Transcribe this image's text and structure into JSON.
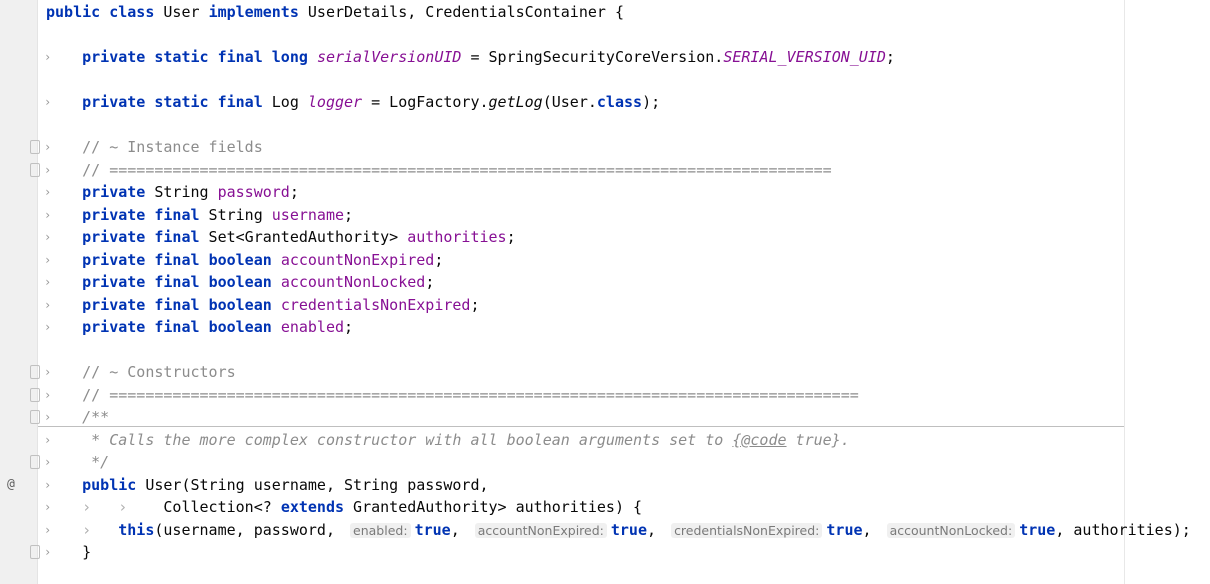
{
  "editor": {
    "language": "java",
    "lines": [
      {
        "fold": "",
        "tokens": [
          [
            "kw",
            "public"
          ],
          [
            "t",
            " "
          ],
          [
            "kw",
            "class"
          ],
          [
            "t",
            " User "
          ],
          [
            "kw",
            "implements"
          ],
          [
            "t",
            " UserDetails, CredentialsContainer {"
          ]
        ]
      },
      {
        "fold": "",
        "tokens": []
      },
      {
        "fold": "›",
        "tokens": [
          [
            "t",
            "    "
          ],
          [
            "kw",
            "private"
          ],
          [
            "t",
            " "
          ],
          [
            "kw",
            "static"
          ],
          [
            "t",
            " "
          ],
          [
            "kw",
            "final"
          ],
          [
            "t",
            " "
          ],
          [
            "kw",
            "long"
          ],
          [
            "t",
            " "
          ],
          [
            "fst",
            "serialVersionUID"
          ],
          [
            "t",
            " = SpringSecurityCoreVersion."
          ],
          [
            "fst",
            "SERIAL_VERSION_UID"
          ],
          [
            "t",
            ";"
          ]
        ]
      },
      {
        "fold": "",
        "tokens": []
      },
      {
        "fold": "›",
        "tokens": [
          [
            "t",
            "    "
          ],
          [
            "kw",
            "private"
          ],
          [
            "t",
            " "
          ],
          [
            "kw",
            "static"
          ],
          [
            "t",
            " "
          ],
          [
            "kw",
            "final"
          ],
          [
            "t",
            " Log "
          ],
          [
            "fst",
            "logger"
          ],
          [
            "t",
            " = LogFactory."
          ],
          [
            "mst",
            "getLog"
          ],
          [
            "t",
            "(User."
          ],
          [
            "kw",
            "class"
          ],
          [
            "t",
            ");"
          ]
        ]
      },
      {
        "fold": "",
        "tokens": []
      },
      {
        "fold": "›",
        "cfold": true,
        "tokens": [
          [
            "t",
            "    "
          ],
          [
            "cm",
            "// ~ Instance fields"
          ]
        ]
      },
      {
        "fold": "›",
        "cfold": true,
        "tokens": [
          [
            "t",
            "    "
          ],
          [
            "cm",
            "// ================================================================================"
          ]
        ]
      },
      {
        "fold": "›",
        "tokens": [
          [
            "t",
            "    "
          ],
          [
            "kw",
            "private"
          ],
          [
            "t",
            " String "
          ],
          [
            "fld",
            "password"
          ],
          [
            "t",
            ";"
          ]
        ]
      },
      {
        "fold": "›",
        "tokens": [
          [
            "t",
            "    "
          ],
          [
            "kw",
            "private"
          ],
          [
            "t",
            " "
          ],
          [
            "kw",
            "final"
          ],
          [
            "t",
            " String "
          ],
          [
            "fld",
            "username"
          ],
          [
            "t",
            ";"
          ]
        ]
      },
      {
        "fold": "›",
        "tokens": [
          [
            "t",
            "    "
          ],
          [
            "kw",
            "private"
          ],
          [
            "t",
            " "
          ],
          [
            "kw",
            "final"
          ],
          [
            "t",
            " Set<GrantedAuthority> "
          ],
          [
            "fld",
            "authorities"
          ],
          [
            "t",
            ";"
          ]
        ]
      },
      {
        "fold": "›",
        "tokens": [
          [
            "t",
            "    "
          ],
          [
            "kw",
            "private"
          ],
          [
            "t",
            " "
          ],
          [
            "kw",
            "final"
          ],
          [
            "t",
            " "
          ],
          [
            "kw",
            "boolean"
          ],
          [
            "t",
            " "
          ],
          [
            "fld",
            "accountNonExpired"
          ],
          [
            "t",
            ";"
          ]
        ]
      },
      {
        "fold": "›",
        "tokens": [
          [
            "t",
            "    "
          ],
          [
            "kw",
            "private"
          ],
          [
            "t",
            " "
          ],
          [
            "kw",
            "final"
          ],
          [
            "t",
            " "
          ],
          [
            "kw",
            "boolean"
          ],
          [
            "t",
            " "
          ],
          [
            "fld",
            "accountNonLocked"
          ],
          [
            "t",
            ";"
          ]
        ]
      },
      {
        "fold": "›",
        "tokens": [
          [
            "t",
            "    "
          ],
          [
            "kw",
            "private"
          ],
          [
            "t",
            " "
          ],
          [
            "kw",
            "final"
          ],
          [
            "t",
            " "
          ],
          [
            "kw",
            "boolean"
          ],
          [
            "t",
            " "
          ],
          [
            "fld",
            "credentialsNonExpired"
          ],
          [
            "t",
            ";"
          ]
        ]
      },
      {
        "fold": "›",
        "tokens": [
          [
            "t",
            "    "
          ],
          [
            "kw",
            "private"
          ],
          [
            "t",
            " "
          ],
          [
            "kw",
            "final"
          ],
          [
            "t",
            " "
          ],
          [
            "kw",
            "boolean"
          ],
          [
            "t",
            " "
          ],
          [
            "fld",
            "enabled"
          ],
          [
            "t",
            ";"
          ]
        ]
      },
      {
        "fold": "",
        "tokens": []
      },
      {
        "fold": "›",
        "cfold": true,
        "tokens": [
          [
            "t",
            "    "
          ],
          [
            "cm",
            "// ~ Constructors"
          ]
        ]
      },
      {
        "fold": "›",
        "cfold": true,
        "tokens": [
          [
            "t",
            "    "
          ],
          [
            "cm",
            "// ==================================================================================="
          ]
        ]
      },
      {
        "fold": "›",
        "cfold": true,
        "tokens": [
          [
            "t",
            "    "
          ],
          [
            "doc",
            "/**"
          ]
        ]
      },
      {
        "fold": "›",
        "tokens": [
          [
            "t",
            "     "
          ],
          [
            "doc",
            "* Calls the more complex constructor with all boolean arguments set to "
          ],
          [
            "doctag",
            "{@code"
          ],
          [
            "doc",
            " true}."
          ]
        ]
      },
      {
        "fold": "›",
        "cfold": true,
        "tokens": [
          [
            "t",
            "     "
          ],
          [
            "doc",
            "*/"
          ]
        ]
      },
      {
        "fold": "›",
        "at": "@",
        "tokens": [
          [
            "t",
            "    "
          ],
          [
            "kw",
            "public"
          ],
          [
            "t",
            " User(String username, String password,"
          ]
        ]
      },
      {
        "fold": "›",
        "tokens": [
          [
            "ind",
            "    ›   › "
          ],
          [
            "t",
            "   Collection<? "
          ],
          [
            "kw",
            "extends"
          ],
          [
            "t",
            " GrantedAuthority> authorities) {"
          ]
        ]
      },
      {
        "fold": "›",
        "tokens": [
          [
            "ind",
            "    ›   "
          ],
          [
            "kw",
            "this"
          ],
          [
            "t",
            "(username, password, "
          ],
          [
            "hint",
            "enabled:"
          ],
          [
            "kw",
            "true"
          ],
          [
            "t",
            ", "
          ],
          [
            "hint",
            "accountNonExpired:"
          ],
          [
            "kw",
            "true"
          ],
          [
            "t",
            ", "
          ],
          [
            "hint",
            "credentialsNonExpired:"
          ],
          [
            "kw",
            "true"
          ],
          [
            "t",
            ", "
          ],
          [
            "hint",
            "accountNonLocked:"
          ],
          [
            "kw",
            "true"
          ],
          [
            "t",
            ", authorities);"
          ]
        ]
      },
      {
        "fold": "›",
        "cfold": true,
        "tokens": [
          [
            "t",
            "    }"
          ]
        ]
      }
    ]
  }
}
